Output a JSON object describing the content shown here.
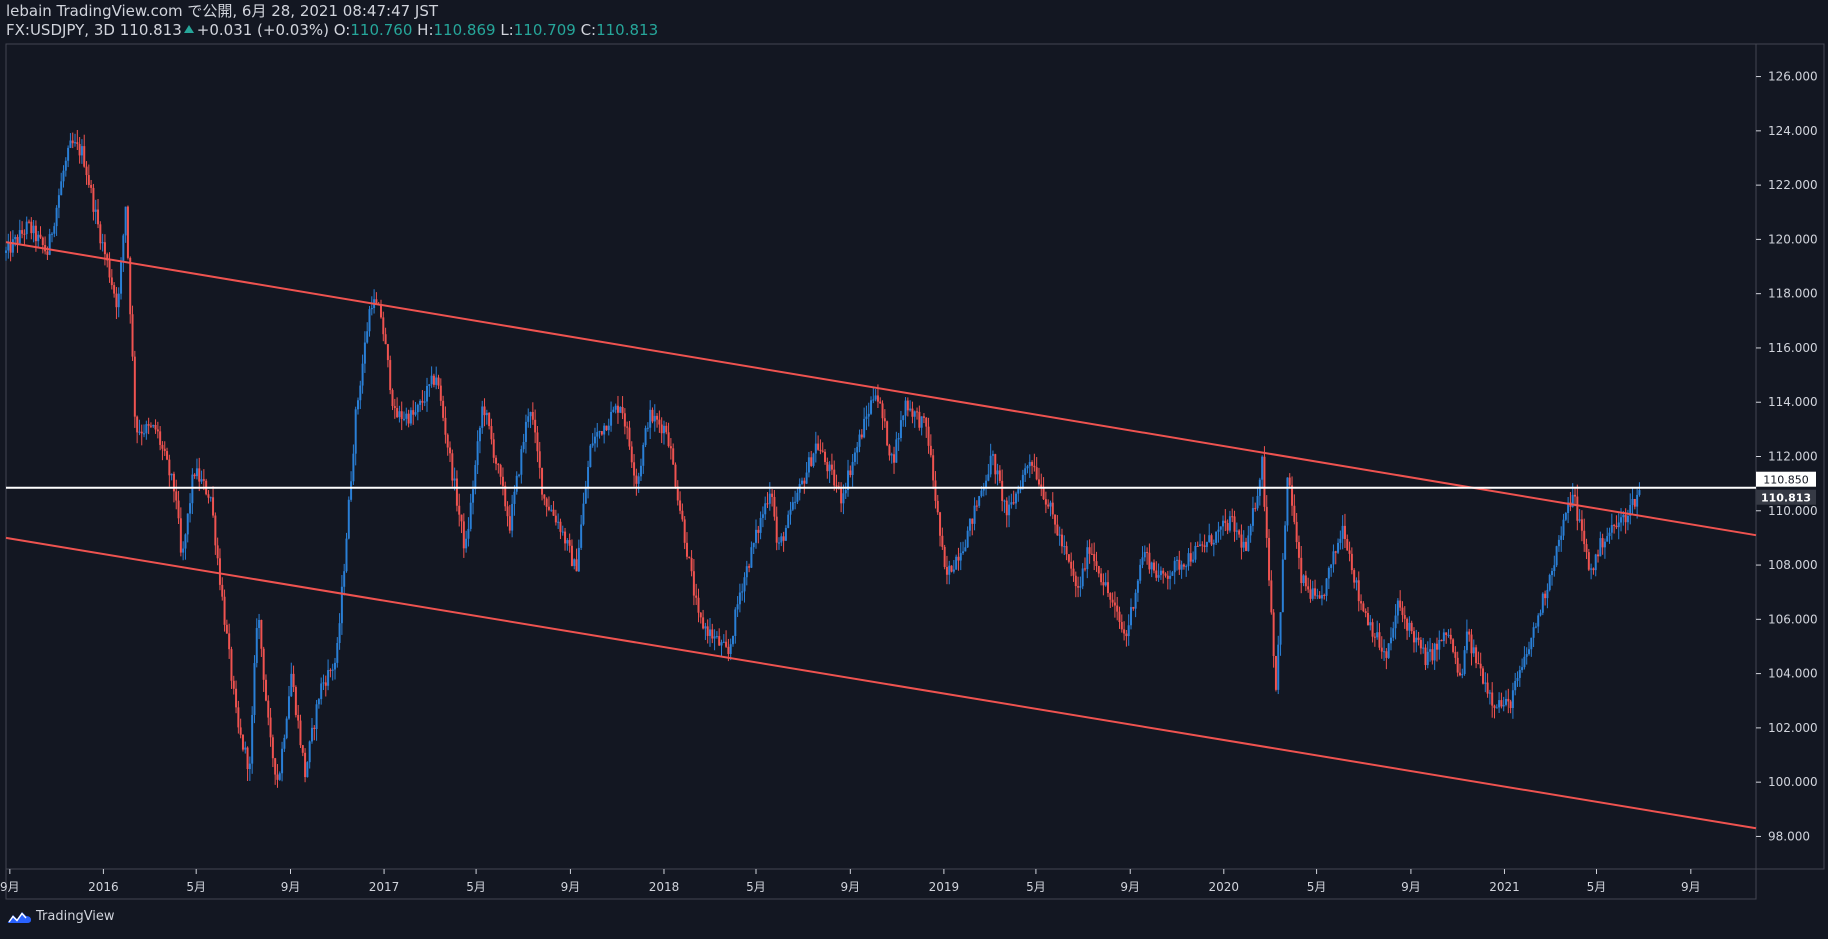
{
  "header": {
    "publisher_line": "lebain TradingView.com で公開, 6月 28, 2021 08:47:47 JST",
    "symbol": "FX:USDJPY, 3D",
    "last": "110.813",
    "change": "+0.031 (+0.03%)",
    "o_label": "O:",
    "o_val": "110.760",
    "h_label": "H:",
    "h_val": "110.869",
    "l_label": "L:",
    "l_val": "110.709",
    "c_label": "C:",
    "c_val": "110.813"
  },
  "footer": {
    "brand": "TradingView",
    "logo_icon": "tradingview-logo-icon"
  },
  "colors": {
    "background": "#131722",
    "up": "#2a7fd6",
    "down": "#ef5350",
    "channel": "#ef5350",
    "hline": "#ffffff",
    "text": "#d1d4dc",
    "accent": "#26a69a"
  },
  "chart_data": {
    "type": "candlestick",
    "title": "FX:USDJPY, 3D",
    "ylim": [
      96.8,
      127.2
    ],
    "y_ticks": [
      98,
      100,
      102,
      104,
      106,
      108,
      110,
      112,
      114,
      116,
      118,
      120,
      122,
      124,
      126
    ],
    "y_tick_labels": [
      "98.000",
      "100.000",
      "102.000",
      "104.000",
      "106.000",
      "108.000",
      "110.000",
      "112.000",
      "114.000",
      "116.000",
      "118.000",
      "120.000",
      "122.000",
      "124.000",
      "126.000"
    ],
    "x_range": [
      "2015-08-27",
      "2021-11-25"
    ],
    "x_ticks": [
      {
        "date": "2015-09-01",
        "label": "9月"
      },
      {
        "date": "2016-01-01",
        "label": "2016"
      },
      {
        "date": "2016-05-01",
        "label": "5月"
      },
      {
        "date": "2016-09-01",
        "label": "9月"
      },
      {
        "date": "2017-01-01",
        "label": "2017"
      },
      {
        "date": "2017-05-01",
        "label": "5月"
      },
      {
        "date": "2017-09-01",
        "label": "9月"
      },
      {
        "date": "2018-01-01",
        "label": "2018"
      },
      {
        "date": "2018-05-01",
        "label": "5月"
      },
      {
        "date": "2018-09-01",
        "label": "9月"
      },
      {
        "date": "2019-01-01",
        "label": "2019"
      },
      {
        "date": "2019-05-01",
        "label": "5月"
      },
      {
        "date": "2019-09-01",
        "label": "9月"
      },
      {
        "date": "2020-01-01",
        "label": "2020"
      },
      {
        "date": "2020-05-01",
        "label": "5月"
      },
      {
        "date": "2020-09-01",
        "label": "9月"
      },
      {
        "date": "2021-01-01",
        "label": "2021"
      },
      {
        "date": "2021-05-01",
        "label": "5月"
      },
      {
        "date": "2021-09-01",
        "label": "9月"
      }
    ],
    "price_path": [
      [
        "2015-08-27",
        119.5
      ],
      [
        "2015-09-25",
        120.5
      ],
      [
        "2015-10-20",
        119.5
      ],
      [
        "2015-11-10",
        122.5
      ],
      [
        "2015-11-20",
        123.5
      ],
      [
        "2015-12-05",
        123.2
      ],
      [
        "2015-12-25",
        120.5
      ],
      [
        "2016-01-20",
        117.5
      ],
      [
        "2016-01-30",
        121.3
      ],
      [
        "2016-02-12",
        113.0
      ],
      [
        "2016-03-10",
        113.0
      ],
      [
        "2016-04-05",
        110.5
      ],
      [
        "2016-04-12",
        108.0
      ],
      [
        "2016-04-28",
        111.5
      ],
      [
        "2016-05-20",
        110.5
      ],
      [
        "2016-06-05",
        106.5
      ],
      [
        "2016-06-24",
        102.0
      ],
      [
        "2016-07-10",
        100.5
      ],
      [
        "2016-07-20",
        106.5
      ],
      [
        "2016-08-05",
        101.5
      ],
      [
        "2016-08-16",
        100.0
      ],
      [
        "2016-09-02",
        104.0
      ],
      [
        "2016-09-20",
        100.3
      ],
      [
        "2016-10-10",
        103.5
      ],
      [
        "2016-10-31",
        104.5
      ],
      [
        "2016-11-10",
        108.0
      ],
      [
        "2016-11-25",
        113.5
      ],
      [
        "2016-12-15",
        117.8
      ],
      [
        "2016-12-28",
        117.2
      ],
      [
        "2017-01-15",
        113.5
      ],
      [
        "2017-02-10",
        113.5
      ],
      [
        "2017-03-10",
        115.0
      ],
      [
        "2017-04-17",
        108.5
      ],
      [
        "2017-05-10",
        114.0
      ],
      [
        "2017-06-14",
        109.5
      ],
      [
        "2017-07-10",
        114.0
      ],
      [
        "2017-07-28",
        110.5
      ],
      [
        "2017-08-18",
        109.5
      ],
      [
        "2017-09-08",
        107.8
      ],
      [
        "2017-09-28",
        112.5
      ],
      [
        "2017-11-06",
        114.0
      ],
      [
        "2017-11-27",
        111.0
      ],
      [
        "2017-12-12",
        113.5
      ],
      [
        "2018-01-05",
        113.0
      ],
      [
        "2018-02-15",
        106.0
      ],
      [
        "2018-03-26",
        104.7
      ],
      [
        "2018-04-10",
        107.0
      ],
      [
        "2018-05-21",
        111.0
      ],
      [
        "2018-05-29",
        108.5
      ],
      [
        "2018-07-19",
        112.5
      ],
      [
        "2018-08-20",
        110.5
      ],
      [
        "2018-10-04",
        114.5
      ],
      [
        "2018-10-26",
        111.8
      ],
      [
        "2018-11-12",
        114.0
      ],
      [
        "2018-12-10",
        113.0
      ],
      [
        "2019-01-03",
        107.5
      ],
      [
        "2019-01-30",
        109.0
      ],
      [
        "2019-03-05",
        112.0
      ],
      [
        "2019-03-25",
        109.8
      ],
      [
        "2019-04-24",
        112.0
      ],
      [
        "2019-05-20",
        110.0
      ],
      [
        "2019-06-25",
        107.0
      ],
      [
        "2019-07-10",
        108.7
      ],
      [
        "2019-08-26",
        105.3
      ],
      [
        "2019-09-18",
        108.5
      ],
      [
        "2019-10-10",
        107.5
      ],
      [
        "2019-12-10",
        108.8
      ],
      [
        "2020-01-10",
        109.6
      ],
      [
        "2020-01-31",
        108.5
      ],
      [
        "2020-02-20",
        111.8
      ],
      [
        "2020-03-09",
        103.5
      ],
      [
        "2020-03-25",
        111.5
      ],
      [
        "2020-04-10",
        107.5
      ],
      [
        "2020-05-05",
        106.5
      ],
      [
        "2020-06-05",
        109.5
      ],
      [
        "2020-06-25",
        106.8
      ],
      [
        "2020-07-31",
        104.5
      ],
      [
        "2020-08-15",
        106.5
      ],
      [
        "2020-09-21",
        104.5
      ],
      [
        "2020-10-20",
        105.5
      ],
      [
        "2020-11-06",
        103.5
      ],
      [
        "2020-11-11",
        105.5
      ],
      [
        "2020-12-17",
        103.0
      ],
      [
        "2021-01-06",
        102.8
      ],
      [
        "2021-01-28",
        104.5
      ],
      [
        "2021-02-18",
        106.5
      ],
      [
        "2021-03-31",
        110.7
      ],
      [
        "2021-04-23",
        107.7
      ],
      [
        "2021-05-10",
        109.0
      ],
      [
        "2021-06-05",
        109.7
      ],
      [
        "2021-06-28",
        110.8
      ]
    ],
    "channel_upper": [
      [
        "2015-08-27",
        119.9
      ],
      [
        "2021-11-25",
        109.1
      ]
    ],
    "channel_lower": [
      [
        "2015-08-27",
        109.0
      ],
      [
        "2021-11-25",
        98.3
      ]
    ],
    "horizontal_line": 110.85,
    "price_labels": [
      {
        "value": 110.85,
        "label": "110.850"
      },
      {
        "value": 110.813,
        "label": "110.813"
      }
    ]
  }
}
